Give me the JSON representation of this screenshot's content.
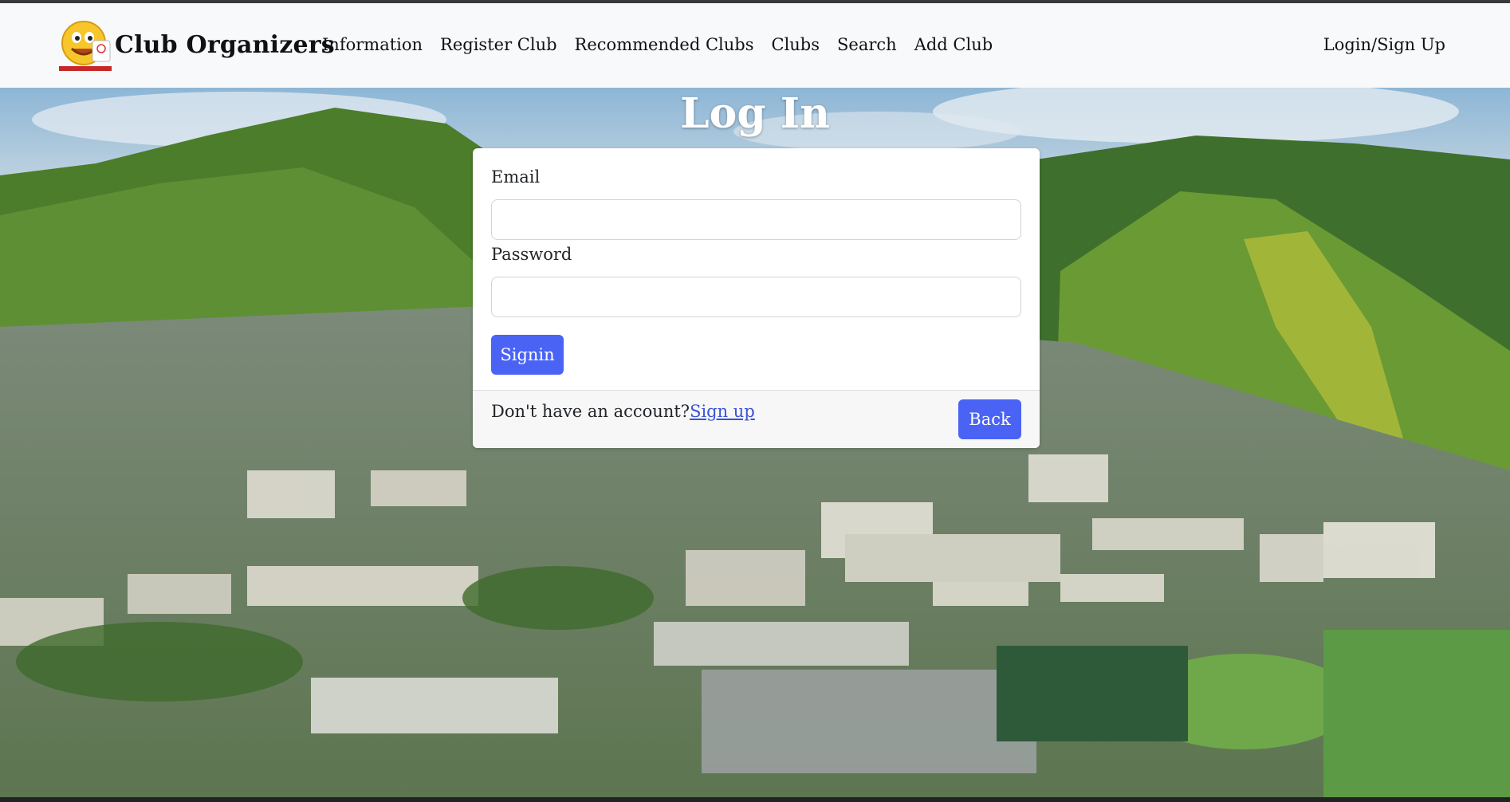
{
  "brand": {
    "name": "Club Organizers",
    "logo_icon": "smiley-logo-icon"
  },
  "nav": {
    "items": [
      {
        "label": "Information"
      },
      {
        "label": "Register Club"
      },
      {
        "label": "Recommended Clubs"
      },
      {
        "label": "Clubs"
      },
      {
        "label": "Search"
      },
      {
        "label": "Add Club"
      }
    ],
    "login_label": "Login/Sign Up"
  },
  "page": {
    "title": "Log In"
  },
  "form": {
    "email_label": "Email",
    "email_value": "",
    "password_label": "Password",
    "password_value": "",
    "signin_label": "Signin"
  },
  "footer": {
    "prompt": "Don't have an account?",
    "signup_label": "Sign up",
    "back_label": "Back"
  },
  "colors": {
    "accent": "#4a63f5",
    "navbar_bg": "#f8f9fa",
    "link": "#3b52d6"
  }
}
